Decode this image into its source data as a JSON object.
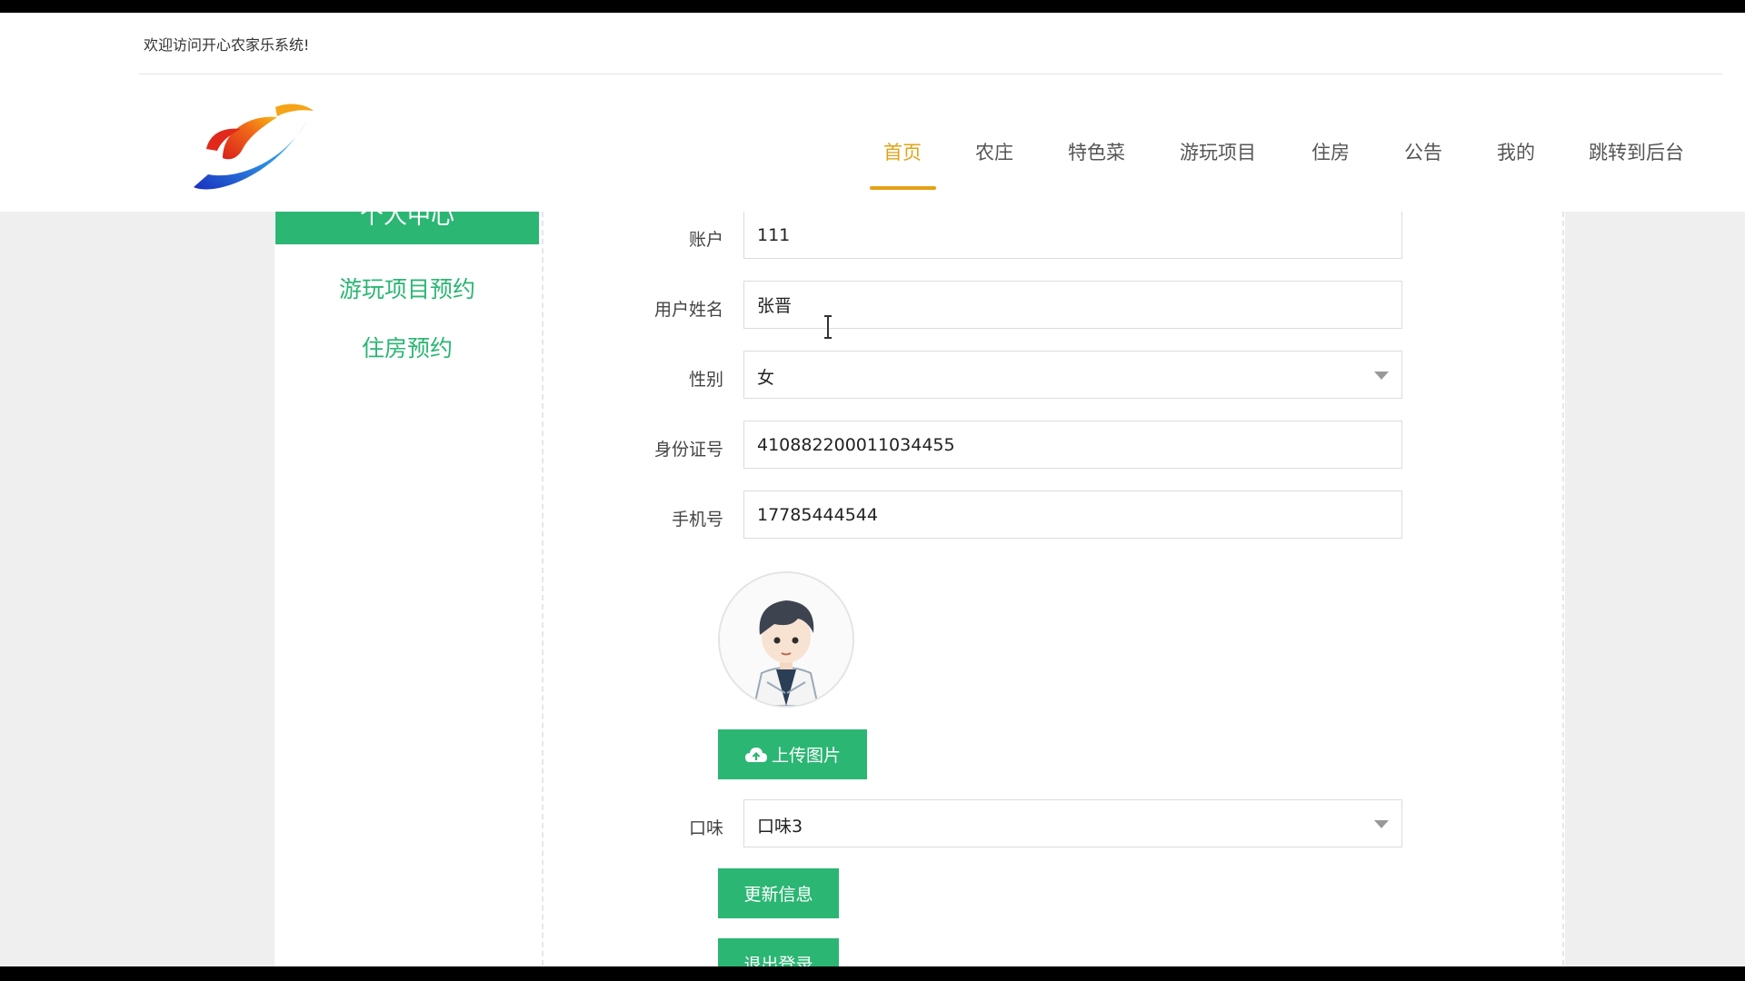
{
  "header": {
    "welcome": "欢迎访问开心农家乐系统!",
    "nav": [
      "首页",
      "农庄",
      "特色菜",
      "游玩项目",
      "住房",
      "公告",
      "我的",
      "跳转到后台"
    ],
    "active_nav": "首页"
  },
  "sidebar": {
    "title": "个人中心",
    "items": [
      {
        "label": "游玩项目预约"
      },
      {
        "label": "住房预约"
      }
    ]
  },
  "form": {
    "account": {
      "label": "账户",
      "value": "111"
    },
    "name": {
      "label": "用户姓名",
      "value": "张晋"
    },
    "gender": {
      "label": "性别",
      "value": "女"
    },
    "id_number": {
      "label": "身份证号",
      "value": "410882200011034455"
    },
    "phone": {
      "label": "手机号",
      "value": "17785444544"
    },
    "upload_label": "上传图片",
    "taste": {
      "label": "口味",
      "value": "口味3"
    },
    "update_label": "更新信息",
    "logout_label": "退出登录"
  },
  "colors": {
    "accent": "#2bb673",
    "nav_active": "#e3a215",
    "page_bg": "#efefef"
  },
  "icons": [
    "logo",
    "chevron-down-icon",
    "cloud-upload-icon",
    "avatar-image",
    "text-cursor-icon"
  ]
}
